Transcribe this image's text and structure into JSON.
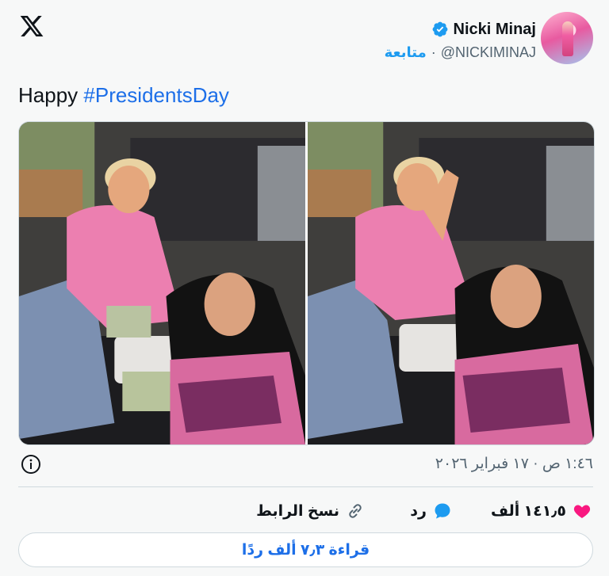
{
  "post": {
    "author": {
      "display_name": "Nicki Minaj",
      "handle": "@NICKIMINAJ",
      "verified": true,
      "follow_label": "متابعة",
      "separator": "·"
    },
    "text": {
      "plain": "Happy ",
      "hashtag": "#PresidentsDay"
    },
    "media": [
      {
        "name": "photo-1",
        "description": "car selfie photo"
      },
      {
        "name": "photo-2",
        "description": "car selfie photo"
      }
    ],
    "timestamp": "١:٤٦ ص · ١٧ فبراير ٢٠٢٦",
    "actions": {
      "like_count": "١٤١٫٥ ألف",
      "reply_label": "رد",
      "copy_link_label": "نسخ الرابط"
    },
    "read_replies_label": "قراءة ٧٫٣ ألف ردًا"
  },
  "icons": {
    "logo": "x-logo-icon",
    "verified": "verified-badge-icon",
    "info": "info-icon",
    "like": "heart-icon",
    "reply": "reply-bubble-icon",
    "copy": "link-icon"
  },
  "colors": {
    "accent": "#1d9bf0",
    "link": "#1d6fe8",
    "like": "#f91880",
    "muted": "#536471",
    "background": "#f7f8f8"
  }
}
